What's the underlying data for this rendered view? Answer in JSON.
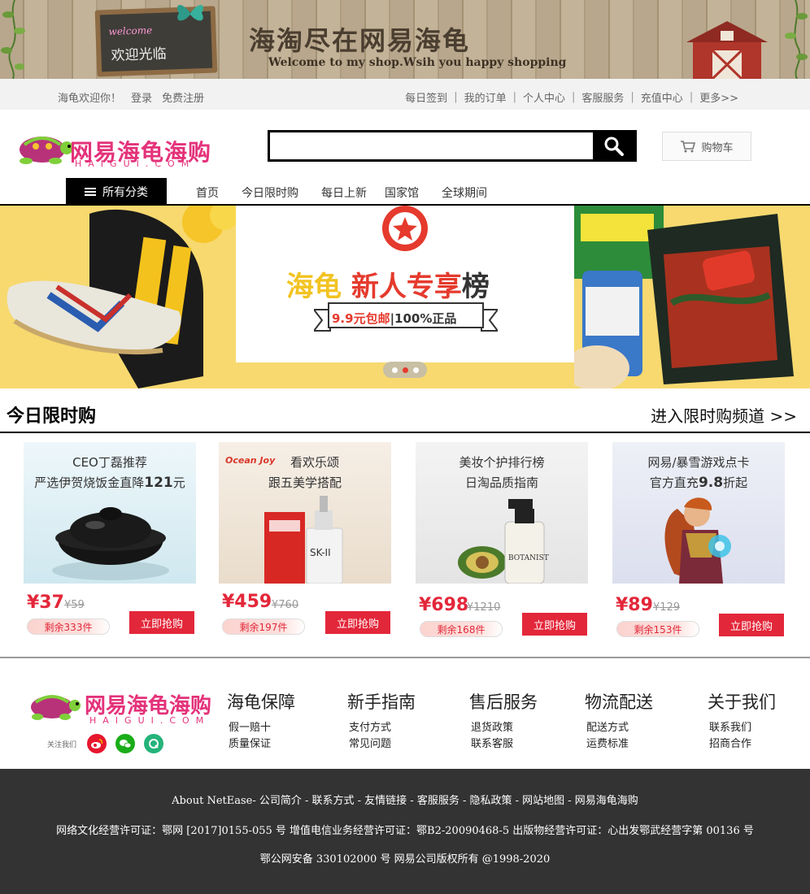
{
  "banner": {
    "welcome_small": "welcome",
    "welcome_cn": "欢迎光临",
    "title": "海淘尽在网易海龟",
    "subtitle": "Welcome to my shop.Wsih you happy shopping"
  },
  "topbar": {
    "greeting": "海龟欢迎你！",
    "login": "登录",
    "register": "免费注册",
    "links": [
      "每日签到",
      "我的订单",
      "个人中心",
      "客服服务",
      "充值中心",
      "更多>>"
    ]
  },
  "header": {
    "logo_text": "网易海龟海购",
    "logo_sub": "HAIGUI.COM",
    "search_placeholder": "",
    "cart_label": "购物车"
  },
  "nav": {
    "all_categories": "所有分类",
    "items": [
      "首页",
      "今日限时购",
      "每日上新",
      "国家馆",
      "全球期间"
    ]
  },
  "hero": {
    "title_part1": "海龟",
    "title_part2": "新人专享",
    "title_part3": "榜",
    "ribbon_red": "9.9元包邮",
    "ribbon_rest": "|100%正品",
    "slide_count": 3,
    "active_slide": 2
  },
  "section": {
    "title": "今日限时购",
    "more": "进入限时购频道 >>"
  },
  "products": [
    {
      "line1": "CEO丁磊推荐",
      "line2": "严选伊贺烧饭金直降",
      "line2_num": "121",
      "line2_tail": "元",
      "price": "¥37",
      "old_price": "¥59",
      "remain": "剩余333件",
      "buy": "立即抢购"
    },
    {
      "line1": "看欢乐颂",
      "line2": "跟五美学搭配",
      "line2_num": "",
      "line2_tail": "",
      "price": "¥459",
      "old_price": "¥760",
      "remain": "剩余197件",
      "buy": "立即抢购"
    },
    {
      "line1": "美妆个护排行榜",
      "line2": "日淘品质指南",
      "line2_num": "",
      "line2_tail": "",
      "price": "¥698",
      "old_price": "¥1210",
      "remain": "剩余168件",
      "buy": "立即抢购"
    },
    {
      "line1": "网易/暴雪游戏点卡",
      "line2": "官方直充",
      "line2_num": "9.8",
      "line2_tail": "折起",
      "price": "¥89",
      "old_price": "¥129",
      "remain": "剩余153件",
      "buy": "立即抢购"
    }
  ],
  "product2_brand": "Ocean Joy",
  "product3_brand": "BOTANIST",
  "footer": {
    "logo_text": "网易海龟海购",
    "logo_sub": "HAIGUI.COM",
    "follow": "关注我们",
    "columns": [
      {
        "title": "海龟保障",
        "items": [
          "假一赔十",
          "质量保证"
        ]
      },
      {
        "title": "新手指南",
        "items": [
          "支付方式",
          "常见问题"
        ]
      },
      {
        "title": "售后服务",
        "items": [
          "退货政策",
          "联系客服"
        ]
      },
      {
        "title": "物流配送",
        "items": [
          "配送方式",
          "运费标准"
        ]
      },
      {
        "title": "关于我们",
        "items": [
          "联系我们",
          "招商合作"
        ]
      }
    ],
    "bottom_line1": "About NetEase- 公司简介 - 联系方式 - 友情链接 - 客服服务 - 隐私政策 - 网站地图 - 网易海龟海购",
    "bottom_line2": "网络文化经营许可证：鄂网 [2017]0155-055 号  增值电信业务经营许可证：鄂B2-20090468-5  出版物经营许可证：心出发鄂武经营字第 00136 号",
    "bottom_line3": "鄂公网安备 330102000 号      网易公司版权所有 @1998-2020"
  },
  "colors": {
    "accent_red": "#E3273A",
    "topbar_bg": "#F2F2F2",
    "footer_bg": "#333333",
    "brand_pink": "#e4327a"
  }
}
